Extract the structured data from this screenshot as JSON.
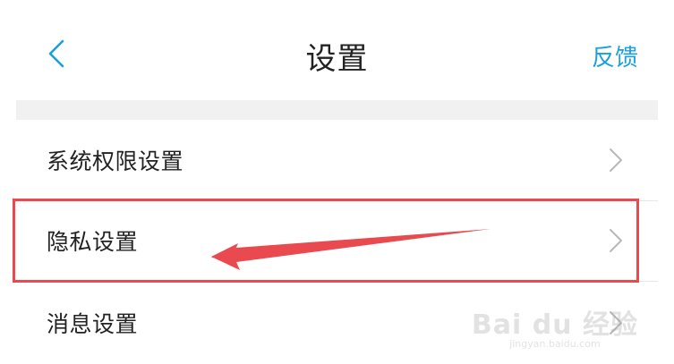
{
  "header": {
    "title": "设置",
    "feedback_label": "反馈",
    "back_icon": "chevron-left-icon",
    "accent_color": "#1a9fe0"
  },
  "settings": {
    "items": [
      {
        "label": "系统权限设置",
        "icon": "chevron-right-icon"
      },
      {
        "label": "隐私设置",
        "icon": "chevron-right-icon"
      },
      {
        "label": "消息设置",
        "icon": "chevron-right-icon"
      }
    ]
  },
  "annotation": {
    "highlight_color": "#e84a4f",
    "highlighted_item": "隐私设置"
  },
  "watermark": {
    "main": "Bai du 经验",
    "sub": "jingyan.baidu.com"
  }
}
